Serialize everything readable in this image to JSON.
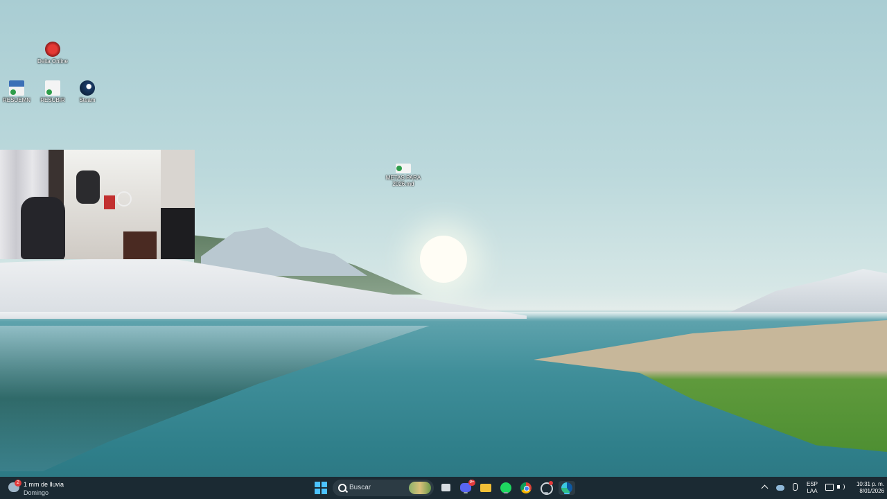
{
  "desktop": {
    "icons": [
      {
        "label": "Delta Online",
        "icon": "delta-online-icon"
      },
      {
        "label": "RESUEMN",
        "icon": "document-sync-icon"
      },
      {
        "label": "RESUBIR",
        "icon": "document-sync-icon"
      },
      {
        "label": "Steam",
        "icon": "steam-icon"
      },
      {
        "label": "METAS PARA 2026.md",
        "icon": "markdown-file-icon"
      }
    ]
  },
  "taskbar": {
    "weather": {
      "line1": "1 mm de lluvia",
      "line2": "Domingo",
      "badge": "2"
    },
    "search_placeholder": "Buscar",
    "apps": [
      "start-icon",
      "task-view-icon",
      "discord-icon",
      "file-explorer-icon",
      "spotify-icon",
      "chrome-icon",
      "app-icon",
      "edge-icon"
    ],
    "discord_badge": "9+",
    "tray": {
      "lang_line1": "ESP",
      "lang_line2": "LAA",
      "time": "10:31 p. m.",
      "date": "8/01/2026"
    }
  },
  "colors": {
    "taskbar": "#1b2a33",
    "accent": "#4cc2ff"
  }
}
